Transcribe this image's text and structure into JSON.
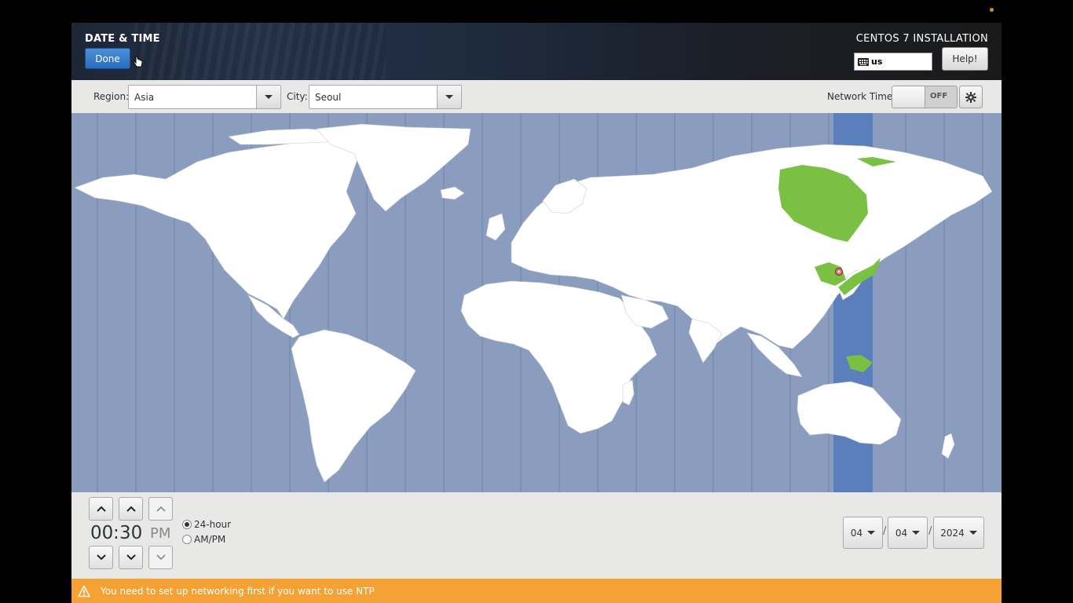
{
  "header": {
    "title": "DATE & TIME",
    "done_label": "Done",
    "install_title": "CENTOS 7 INSTALLATION",
    "keyboard_layout": "us",
    "help_label": "Help!"
  },
  "toolbar": {
    "region_label": "Region:",
    "region_value": "Asia",
    "city_label": "City:",
    "city_value": "Seoul",
    "network_time_label": "Network Time",
    "network_time_state": "OFF"
  },
  "time": {
    "hours": "00",
    "separator": ":",
    "minutes": "30",
    "ampm": "PM",
    "format_24_label": "24-hour",
    "format_ampm_label": "AM/PM",
    "selected_format": "24-hour"
  },
  "date": {
    "month": "04",
    "day": "04",
    "year": "2024",
    "separator": "/"
  },
  "warning": {
    "text": "You need to set up networking first if you want to use NTP"
  },
  "colors": {
    "ocean": "#8a9dbf",
    "land": "#ffffff",
    "selected_zone": "#5b7fbd",
    "selected_land": "#7ac143",
    "warning_bar": "#f6a134",
    "done_button": "#3a7dcc"
  },
  "icons": {
    "keyboard": "keyboard-icon",
    "gear": "gear-icon",
    "warning": "warning-icon",
    "map_pin": "location-pin-icon"
  }
}
